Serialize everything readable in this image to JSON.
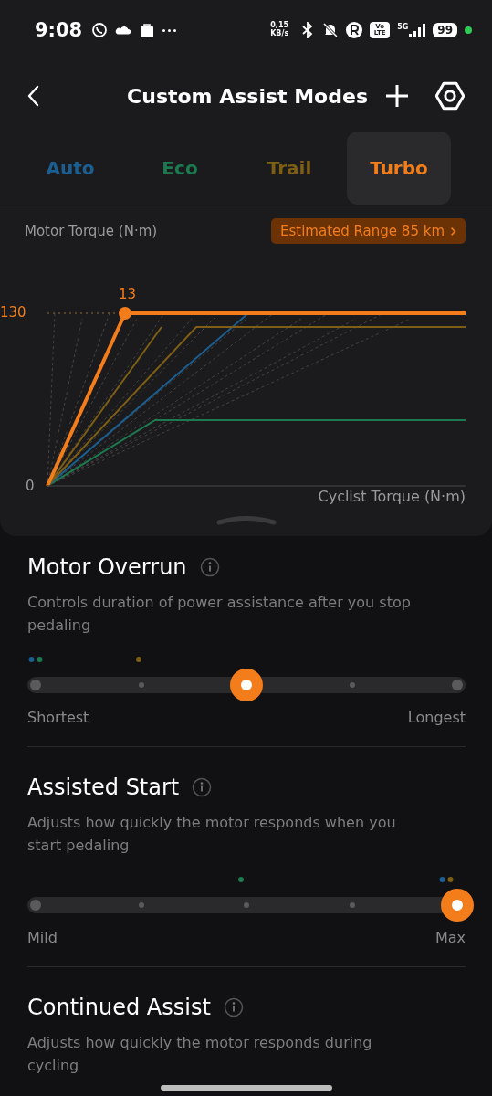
{
  "status_bar": {
    "time": "9:08",
    "speed": "0,15 KB/s",
    "volte": "Vo LTE",
    "network": "5G",
    "battery": "99"
  },
  "header": {
    "title": "Custom Assist Modes"
  },
  "tabs": [
    {
      "label": "Auto",
      "color": "#1b5f92",
      "selected": false
    },
    {
      "label": "Eco",
      "color": "#1d7a50",
      "selected": false
    },
    {
      "label": "Trail",
      "color": "#7d5e14",
      "selected": false
    },
    {
      "label": "Turbo",
      "color": "#f27d1a",
      "selected": true
    }
  ],
  "chart": {
    "ylabel": "Motor Torque (N·m)",
    "range_button": "Estimated Range 85 km",
    "y_max_label": "130",
    "y_min_label": "0",
    "point_label": "13",
    "xlabel": "Cyclist Torque (N·m)"
  },
  "settings": [
    {
      "title": "Motor Overrun",
      "description": "Controls duration of power assistance after you stop pedaling",
      "min_label": "Shortest",
      "max_label": "Longest",
      "steps": [
        {
          "selected": false,
          "markers": [
            {
              "color": "#1b5f92"
            },
            {
              "color": "#1d7a50"
            }
          ]
        },
        {
          "selected": false,
          "markers": [
            {
              "color": "#7d5e14"
            }
          ]
        },
        {
          "selected": true
        },
        {
          "selected": false
        },
        {
          "selected": false
        }
      ]
    },
    {
      "title": "Assisted Start",
      "description": "Adjusts how quickly the motor responds when you start pedaling",
      "min_label": "Mild",
      "max_label": "Max",
      "steps": [
        {
          "selected": false
        },
        {
          "selected": false
        },
        {
          "selected": false,
          "markers": [
            {
              "color": "#1d7a50"
            }
          ]
        },
        {
          "selected": false
        },
        {
          "selected": true,
          "markers": [
            {
              "color": "#1b5f92"
            },
            {
              "color": "#7d5e14"
            }
          ]
        }
      ]
    },
    {
      "title": "Continued Assist",
      "description": "Adjusts how quickly the motor responds during cycling"
    }
  ]
}
